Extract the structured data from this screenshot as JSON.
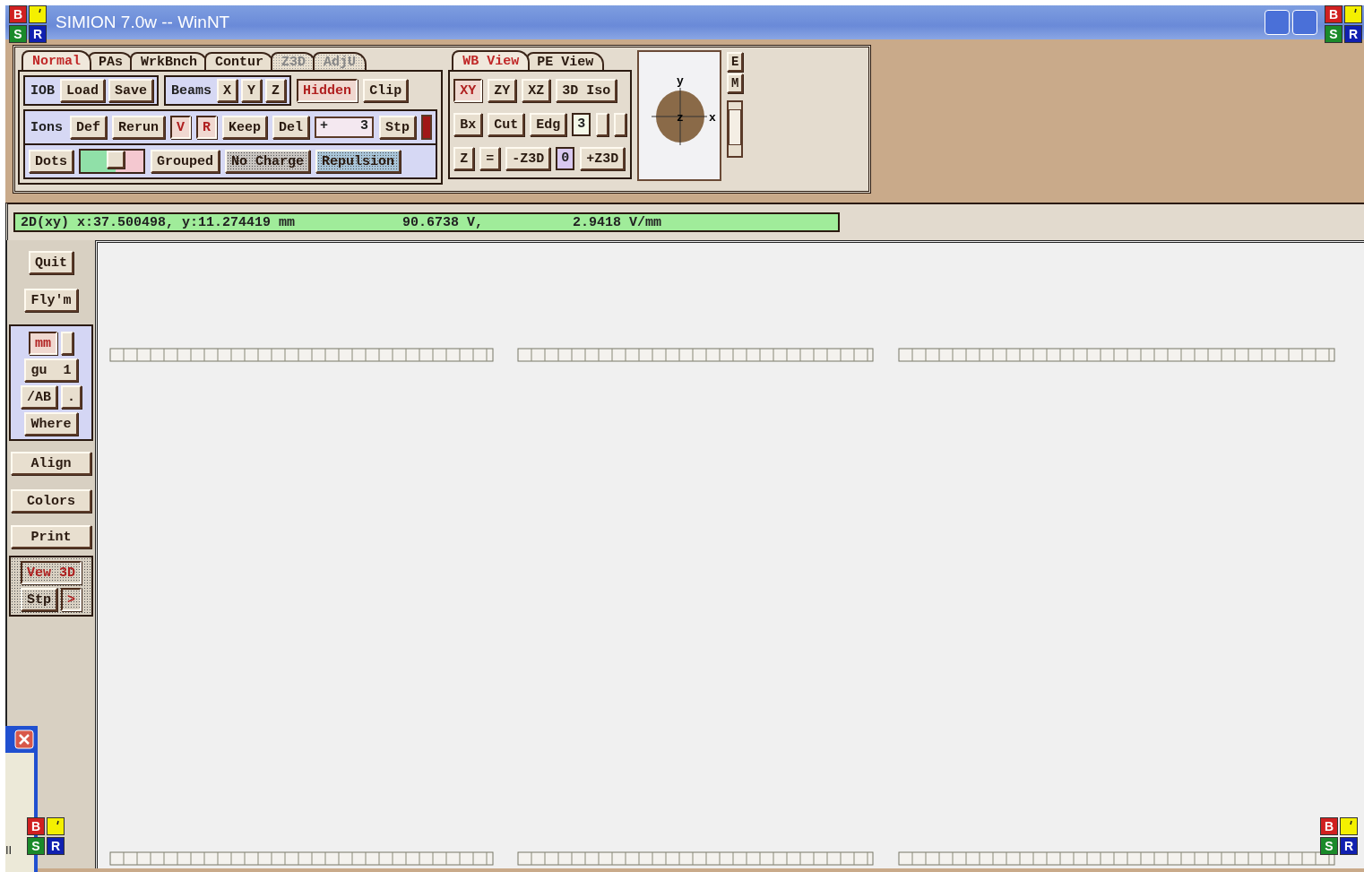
{
  "window": {
    "title": "SIMION 7.0w -- WinNT"
  },
  "left_panel": {
    "tabs": [
      {
        "label": "Normal",
        "selected": true,
        "disabled": false
      },
      {
        "label": "PAs",
        "selected": false,
        "disabled": false
      },
      {
        "label": "WrkBnch",
        "selected": false,
        "disabled": false
      },
      {
        "label": "Contur",
        "selected": false,
        "disabled": false
      },
      {
        "label": "Z3D",
        "selected": false,
        "disabled": true
      },
      {
        "label": "AdjU",
        "selected": false,
        "disabled": true
      }
    ],
    "rows": [
      {
        "framed": false,
        "items": [
          {
            "kind": "group",
            "items": [
              {
                "kind": "label",
                "text": "IOB"
              },
              {
                "kind": "button",
                "label": "Load",
                "pressed": false
              },
              {
                "kind": "button",
                "label": "Save",
                "pressed": false
              }
            ]
          },
          {
            "kind": "group",
            "items": [
              {
                "kind": "label",
                "text": "Beams"
              },
              {
                "kind": "button",
                "label": "X",
                "pressed": false
              },
              {
                "kind": "button",
                "label": "Y",
                "pressed": false
              },
              {
                "kind": "button",
                "label": "Z",
                "pressed": false
              }
            ]
          },
          {
            "kind": "button",
            "label": "Hidden",
            "pressed": true
          },
          {
            "kind": "button",
            "label": "Clip",
            "pressed": false
          }
        ]
      },
      {
        "framed": true,
        "items": [
          {
            "kind": "label",
            "text": "Ions"
          },
          {
            "kind": "button",
            "label": "Def",
            "pressed": false
          },
          {
            "kind": "button",
            "label": "Rerun",
            "pressed": false
          },
          {
            "kind": "button",
            "label": "V",
            "pressed": true
          },
          {
            "kind": "button",
            "label": "R",
            "pressed": true
          },
          {
            "kind": "button",
            "label": "Keep",
            "pressed": false
          },
          {
            "kind": "button",
            "label": "Del",
            "pressed": false
          },
          {
            "kind": "spinner",
            "sign": "+",
            "value": "3"
          },
          {
            "kind": "button",
            "label": "Stp",
            "pressed": false
          },
          {
            "kind": "indicator",
            "on": true
          }
        ]
      },
      {
        "framed": true,
        "items": [
          {
            "kind": "button",
            "label": "Dots",
            "pressed": false
          },
          {
            "kind": "slider",
            "level": 0.55
          },
          {
            "kind": "button",
            "label": "Grouped",
            "pressed": false
          },
          {
            "kind": "toggle",
            "label": "No Charge",
            "color": "#c8c4c0"
          },
          {
            "kind": "toggle",
            "label": "Repulsion",
            "color": "#a8c4d8"
          }
        ]
      }
    ]
  },
  "right_panel": {
    "tabs": [
      {
        "label": "WB View",
        "selected": true,
        "disabled": false
      },
      {
        "label": "PE View",
        "selected": false,
        "disabled": false
      }
    ],
    "rows": [
      {
        "framed": false,
        "items": [
          {
            "kind": "button",
            "label": "XY",
            "pressed": true
          },
          {
            "kind": "button",
            "label": "ZY",
            "pressed": false
          },
          {
            "kind": "button",
            "label": "XZ",
            "pressed": false
          },
          {
            "kind": "button",
            "label": "3D Iso",
            "pressed": false
          }
        ]
      },
      {
        "framed": false,
        "items": [
          {
            "kind": "button",
            "label": "Bx",
            "pressed": false
          },
          {
            "kind": "button",
            "label": "Cut",
            "pressed": false
          },
          {
            "kind": "button",
            "label": "Edg",
            "pressed": false
          },
          {
            "kind": "field",
            "value": "3",
            "color": "#f4f8e8"
          },
          {
            "kind": "blank"
          },
          {
            "kind": "blank"
          }
        ]
      },
      {
        "framed": false,
        "items": [
          {
            "kind": "button",
            "label": "Z",
            "pressed": false
          },
          {
            "kind": "button",
            "label": "=",
            "pressed": false
          },
          {
            "kind": "button",
            "label": "-Z3D",
            "pressed": false
          },
          {
            "kind": "field",
            "value": "0",
            "color": "#d8c8f0"
          },
          {
            "kind": "button",
            "label": "+Z3D",
            "pressed": false
          }
        ]
      }
    ]
  },
  "orientation": {
    "axes": [
      "y",
      "z",
      "x"
    ]
  },
  "side_buttons": [
    {
      "label": "E"
    },
    {
      "label": "M"
    }
  ],
  "status": [
    "2D(xy) x:37.500498, y:11.274419 mm",
    "90.6738 V,",
    "2.9418 V/mm"
  ],
  "sidebar": [
    {
      "kind": "button",
      "label": "Quit"
    },
    {
      "kind": "button",
      "label": "Fly'm"
    },
    {
      "kind": "frame",
      "dithered": false,
      "rows": [
        [
          {
            "kind": "button",
            "label": "mm",
            "pressed": true
          },
          {
            "kind": "blank"
          }
        ],
        [
          {
            "kind": "button",
            "label": "gu  1",
            "pressed": false
          }
        ],
        [
          {
            "kind": "button",
            "label": "/AB",
            "pressed": false
          },
          {
            "kind": "button",
            "label": ".",
            "pressed": false
          }
        ],
        [
          {
            "kind": "button",
            "label": "Where",
            "pressed": false
          }
        ]
      ]
    },
    {
      "kind": "button",
      "label": "Align"
    },
    {
      "kind": "button",
      "label": "Colors"
    },
    {
      "kind": "button",
      "label": "Print"
    },
    {
      "kind": "frame",
      "dithered": true,
      "rows": [
        [
          {
            "kind": "button",
            "label": "Vew 3D",
            "pressed": true
          }
        ],
        [
          {
            "kind": "button",
            "label": "Stp",
            "pressed": false
          },
          {
            "kind": "button",
            "label": ">",
            "pressed": true
          }
        ]
      ]
    }
  ],
  "mini_window": {
    "text": "II"
  },
  "markers": [
    {
      "letters": [
        "B",
        "S",
        "R"
      ]
    },
    {
      "letters": [
        "B",
        "S",
        "R"
      ]
    },
    {
      "letters": [
        "B",
        "S",
        "R"
      ]
    },
    {
      "letters": [
        "B",
        "S",
        "R"
      ]
    }
  ]
}
